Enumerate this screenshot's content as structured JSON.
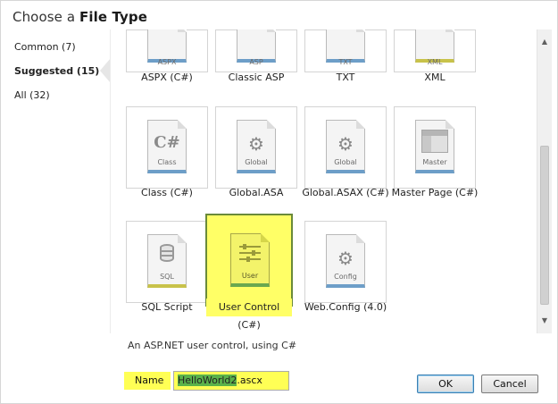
{
  "dialog": {
    "title_prefix": "Choose a",
    "title_bold": "File Type"
  },
  "categories": [
    {
      "label": "Common (7)",
      "selected": false
    },
    {
      "label": "Suggested (15)",
      "selected": true
    },
    {
      "label": "All (32)",
      "selected": false
    }
  ],
  "tiles": [
    {
      "name": "ASPX (C#)",
      "tag": "ASPX"
    },
    {
      "name": "Classic ASP",
      "tag": "ASP"
    },
    {
      "name": "TXT",
      "tag": "TXT"
    },
    {
      "name": "XML",
      "tag": "XML"
    },
    {
      "name": "Class (C#)",
      "tag": "Class",
      "glyph": "C#"
    },
    {
      "name": "Global.ASA",
      "tag": "Global",
      "glyph": "⚙"
    },
    {
      "name": "Global.ASAX (C#)",
      "tag": "Global",
      "glyph": "⚙"
    },
    {
      "name": "Master Page (C#)",
      "tag": "Master"
    },
    {
      "name": "SQL Script",
      "tag": "SQL"
    },
    {
      "name": "User Control (C#)",
      "tag": "User",
      "selected": true
    },
    {
      "name": "Web.Config (4.0)",
      "tag": "Config",
      "glyph": "⚙"
    }
  ],
  "scrollbar": {
    "up_icon": "▲",
    "down_icon": "▼"
  },
  "description": "An ASP.NET user control, using C#",
  "name_field": {
    "label": "Name",
    "value_selected": "HelloWorld2",
    "value_ext": ".ascx"
  },
  "buttons": {
    "ok": "OK",
    "cancel": "Cancel"
  }
}
